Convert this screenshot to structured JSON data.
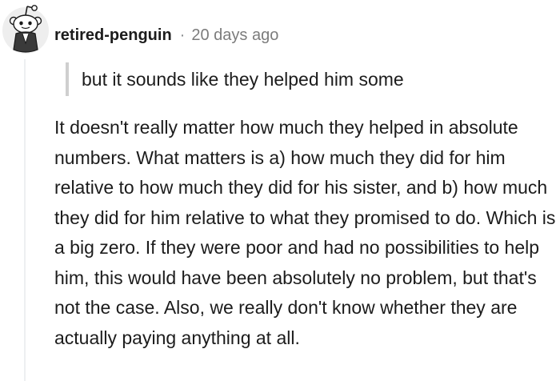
{
  "comment": {
    "username": "retired-penguin",
    "separator": "·",
    "timestamp": "20 days ago",
    "quote": "but it sounds like they helped him some",
    "body": "It doesn't really matter how much they helped in absolute numbers. What matters is a) how much they did for him relative to how much they did for his sister, and b) how much they did for him relative to what they promised to do. Which is a big zero. If they were poor and had no possibilities to help him, this would have been absolutely no problem, but that's not the case. Also, we really don't know whether they are actually paying anything at all."
  },
  "icons": {
    "avatar": "snoo-avatar-icon"
  },
  "colors": {
    "username": "#1c1c1c",
    "timestamp": "#7c7c7c",
    "quote_bar": "#cfcfcf",
    "thread_line": "#edeff1",
    "body_text": "#1c1c1c"
  }
}
